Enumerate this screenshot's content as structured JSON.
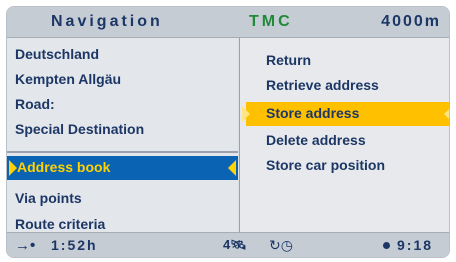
{
  "topbar": {
    "title": "Navigation",
    "tmc": "TMC",
    "distance": "4000m"
  },
  "left_menu": {
    "items": [
      "Deutschland",
      "Kempten Allgäu",
      "Road:",
      "Special Destination"
    ],
    "selected": "Address book",
    "lower_items": [
      "Via points",
      "Route criteria"
    ]
  },
  "right_menu": {
    "items": [
      "Return",
      "Retrieve address"
    ],
    "selected": "Store address",
    "lower_items": [
      "Delete address",
      "Store car position"
    ]
  },
  "status": {
    "arrow": "→•",
    "travel_time": "1:52h",
    "satellites": "4",
    "clock": "9:18"
  },
  "colors": {
    "text": "#1c3766",
    "tmc": "#1f8a38",
    "selected_left": "#0b63b4",
    "selected_left_text": "#ffd200",
    "selected_right": "#ffc000"
  }
}
